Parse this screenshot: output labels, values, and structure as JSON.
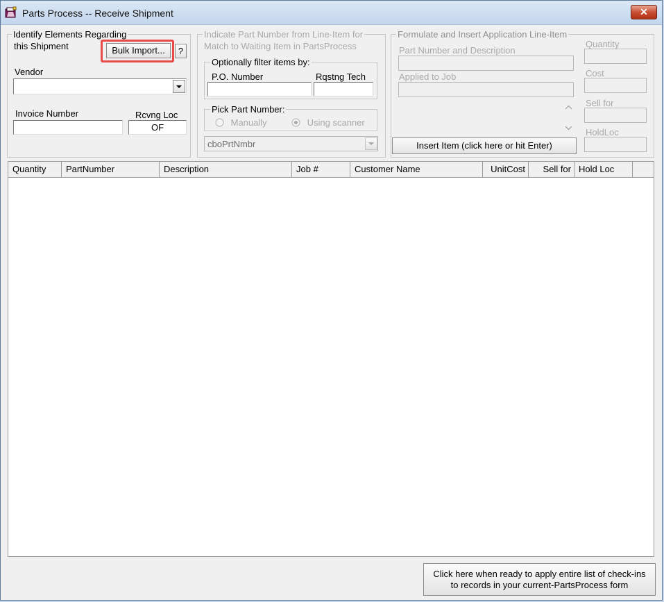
{
  "window": {
    "title": "Parts Process -- Receive Shipment",
    "close_glyph": "✕"
  },
  "identify": {
    "legend_line1": "Identify Elements Regarding",
    "legend_line2": "this Shipment",
    "bulk_import_label": "Bulk Import...",
    "help_label": "?",
    "vendor_label": "Vendor",
    "vendor_value": "",
    "invoice_label": "Invoice Number",
    "invoice_value": "",
    "rcvng_loc_label": "Rcvng Loc",
    "rcvng_loc_value": "OF"
  },
  "indicate": {
    "legend_line1": "Indicate Part Number from Line-Item for",
    "legend_line2": "Match to Waiting Item in PartsProcess",
    "filter_legend": "Optionally filter items by:",
    "po_label": "P.O. Number",
    "po_value": "",
    "tech_label": "Rqstng Tech",
    "tech_value": "",
    "pick_legend": "Pick Part Number:",
    "radio_manually": "Manually",
    "radio_scanner": "Using scanner",
    "selected_mode": "Using scanner",
    "part_combo_value": "cboPrtNmbr"
  },
  "formulate": {
    "legend": "Formulate and Insert Application Line-Item",
    "part_desc_label": "Part Number and Description",
    "applied_job_label": "Applied to Job",
    "insert_button": "Insert Item (click here or hit Enter)",
    "quantity_label": "Quantity",
    "cost_label": "Cost",
    "sell_for_label": "Sell for",
    "holdloc_label": "HoldLoc"
  },
  "table": {
    "columns": [
      "Quantity",
      "PartNumber",
      "Description",
      "Job #",
      "Customer Name",
      "UnitCost",
      "Sell for",
      "Hold Loc"
    ],
    "rows": []
  },
  "apply": {
    "line1": "Click here when ready to apply entire list of check-ins",
    "line2": "to records in your current-PartsProcess form"
  },
  "colors": {
    "highlight": "#e84a4a",
    "close_button": "#c54a2f"
  },
  "icons": {
    "app": "parts-process-app-icon",
    "dropdown": "chevron-down-icon",
    "scroll_up": "chevron-up-icon",
    "scroll_down": "chevron-down-icon"
  }
}
